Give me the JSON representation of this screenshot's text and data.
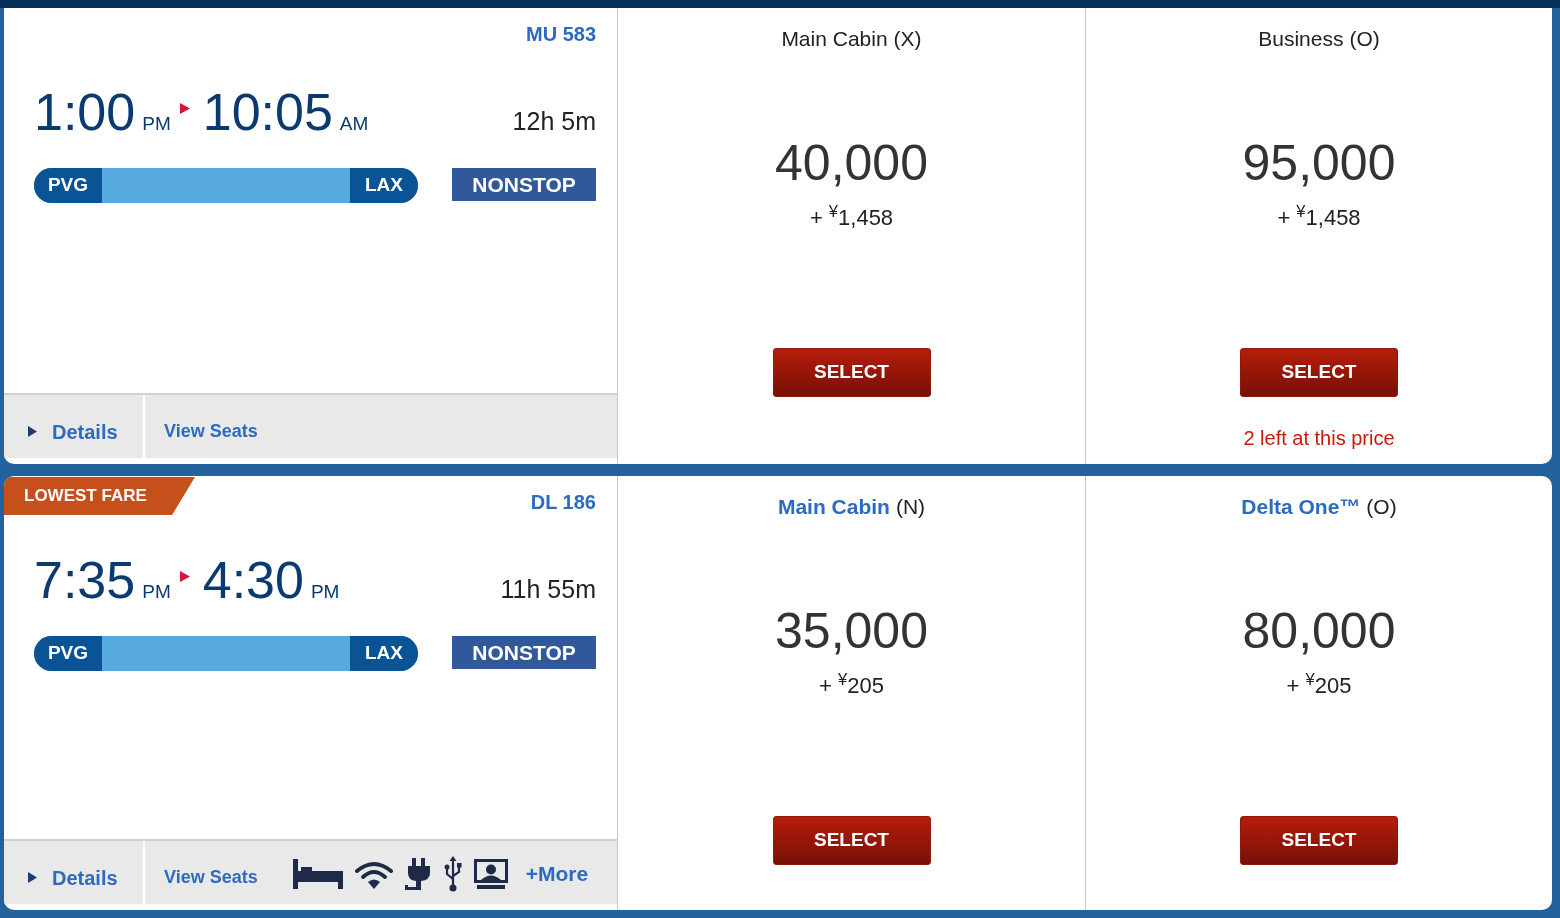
{
  "flights": [
    {
      "flight_number": "MU 583",
      "departure": {
        "time": "1:00",
        "period": "PM"
      },
      "arrival": {
        "time": "10:05",
        "period": "AM"
      },
      "duration": "12h 5m",
      "origin": "PVG",
      "destination": "LAX",
      "stops": "NONSTOP",
      "details_link": "Details",
      "seats_link": "View Seats",
      "amenity_icons": false,
      "fares": [
        {
          "cabin": "Main Cabin",
          "fare_class": "(X)",
          "cabin_link": false,
          "miles": "40,000",
          "taxes": "+ $^{¥}$1,458",
          "button": "SELECT"
        },
        {
          "cabin": "Business",
          "fare_class": "(O)",
          "cabin_link": false,
          "miles": "95,000",
          "taxes": "+ $^{¥}$1,458",
          "button": "SELECT",
          "seats_left": "2 left at this price"
        }
      ]
    },
    {
      "badge": "LOWEST FARE",
      "flight_number": "DL 186",
      "departure": {
        "time": "7:35",
        "period": "PM"
      },
      "arrival": {
        "time": "4:30",
        "period": "PM"
      },
      "duration": "11h 55m",
      "origin": "PVG",
      "destination": "LAX",
      "stops": "NONSTOP",
      "details_link": "Details",
      "seats_link": "View Seats",
      "amenity_icons": true,
      "more_link": "+More",
      "fares": [
        {
          "cabin": "Main Cabin",
          "fare_class": "(N)",
          "cabin_link": true,
          "miles": "35,000",
          "taxes": "+ $^{¥}$205",
          "button": "SELECT"
        },
        {
          "cabin": "Delta One™",
          "fare_class": "(O)",
          "cabin_link": true,
          "miles": "80,000",
          "taxes": "+ $^{¥}$205",
          "button": "SELECT"
        }
      ]
    }
  ]
}
